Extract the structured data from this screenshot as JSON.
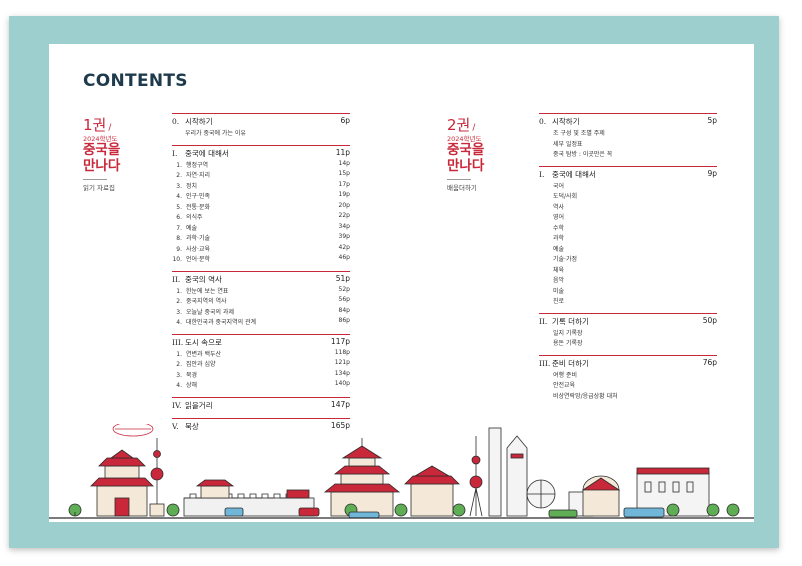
{
  "contents_title": "CONTENTS",
  "volume1": {
    "label": "1권",
    "slash": "/",
    "year": "2024학년도",
    "title_lines": [
      "중국을",
      "만나다"
    ],
    "subtitle": "읽기 자료집",
    "sections": [
      {
        "num": "0.",
        "title": "시작하기",
        "page": "6p",
        "items": [
          {
            "n": "",
            "text": "우리가 중국에 가는 이유",
            "page": ""
          }
        ]
      },
      {
        "num": "I.",
        "title": "중국에 대해서",
        "page": "11p",
        "items": [
          {
            "n": "1.",
            "text": "행정구역",
            "page": "14p"
          },
          {
            "n": "2.",
            "text": "자연·지리",
            "page": "15p"
          },
          {
            "n": "3.",
            "text": "정치",
            "page": "17p"
          },
          {
            "n": "4.",
            "text": "인구·민족",
            "page": "19p"
          },
          {
            "n": "5.",
            "text": "전통·문화",
            "page": "20p"
          },
          {
            "n": "6.",
            "text": "의식주",
            "page": "22p"
          },
          {
            "n": "7.",
            "text": "예술",
            "page": "34p"
          },
          {
            "n": "8.",
            "text": "과학·기술",
            "page": "39p"
          },
          {
            "n": "9.",
            "text": "사상·교육",
            "page": "42p"
          },
          {
            "n": "10.",
            "text": "언어·문학",
            "page": "46p"
          }
        ]
      },
      {
        "num": "II.",
        "title": "중국의 역사",
        "page": "51p",
        "items": [
          {
            "n": "1.",
            "text": "한눈에 보는 연표",
            "page": "52p"
          },
          {
            "n": "2.",
            "text": "중국지역의 역사",
            "page": "56p"
          },
          {
            "n": "3.",
            "text": "오늘날 중국의 과제",
            "page": "84p"
          },
          {
            "n": "4.",
            "text": "대한민국과 중국지역의 관계",
            "page": "86p"
          }
        ]
      },
      {
        "num": "III.",
        "title": "도시 속으로",
        "page": "117p",
        "items": [
          {
            "n": "1.",
            "text": "연변과 백두산",
            "page": "118p"
          },
          {
            "n": "2.",
            "text": "집안과 심양",
            "page": "121p"
          },
          {
            "n": "3.",
            "text": "북경",
            "page": "134p"
          },
          {
            "n": "4.",
            "text": "상해",
            "page": "140p"
          }
        ]
      },
      {
        "num": "IV.",
        "title": "읽을거리",
        "page": "147p",
        "items": []
      },
      {
        "num": "V.",
        "title": "묵상",
        "page": "165p",
        "items": []
      }
    ]
  },
  "volume2": {
    "label": "2권",
    "slash": "/",
    "year": "2024학년도",
    "title_lines": [
      "중국을",
      "만나다"
    ],
    "subtitle": "배움더하기",
    "sections": [
      {
        "num": "0.",
        "title": "시작하기",
        "page": "5p",
        "items": [
          "조 구성 및 조별 주제",
          "세부 일정표",
          "중국 탐방 : 이곳만은 꼭"
        ]
      },
      {
        "num": "I.",
        "title": "중국에 대해서",
        "page": "9p",
        "items": [
          "국어",
          "도덕/사회",
          "역사",
          "영어",
          "수학",
          "과학",
          "예술",
          "기술·가정",
          "체육",
          "음악",
          "미술",
          "진로"
        ]
      },
      {
        "num": "II.",
        "title": "기록 더하기",
        "page": "50p",
        "items": [
          "일지 기록장",
          "용돈 기록장"
        ]
      },
      {
        "num": "III.",
        "title": "준비 더하기",
        "page": "76p",
        "items": [
          "여행 준비",
          "안전교육",
          "비상연락망/응급상황 대처"
        ]
      }
    ]
  },
  "colors": {
    "accent_red": "#c8283a",
    "title_navy": "#1e3a4c",
    "frame_teal": "#9ccfcd"
  }
}
